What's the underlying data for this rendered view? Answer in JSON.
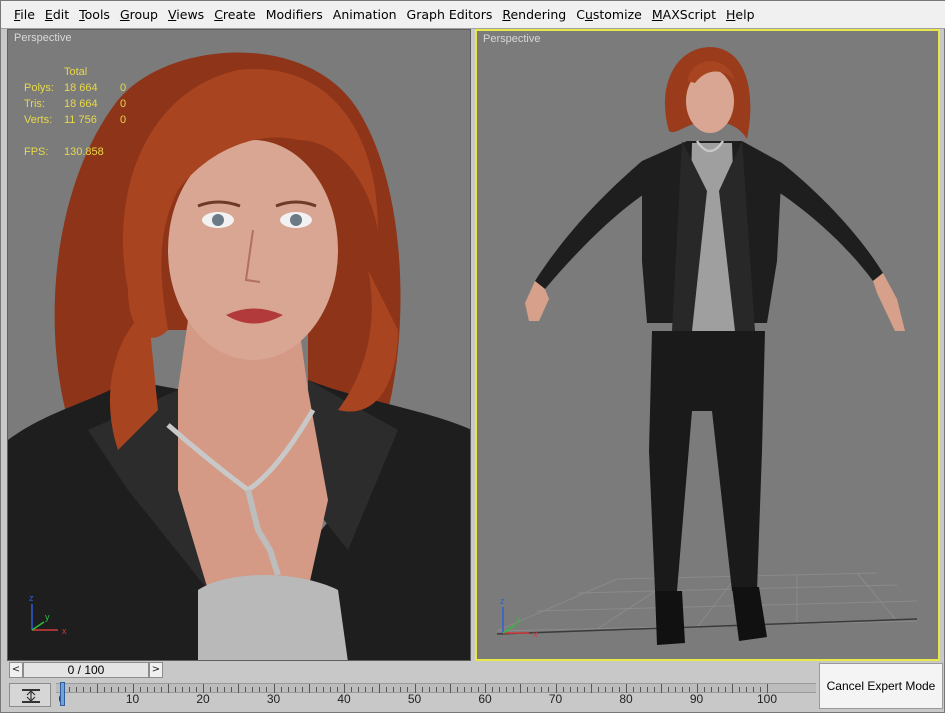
{
  "menu": [
    {
      "pre": "",
      "ul": "F",
      "post": "ile"
    },
    {
      "pre": "",
      "ul": "E",
      "post": "dit"
    },
    {
      "pre": "",
      "ul": "T",
      "post": "ools"
    },
    {
      "pre": "",
      "ul": "G",
      "post": "roup"
    },
    {
      "pre": "",
      "ul": "V",
      "post": "iews"
    },
    {
      "pre": "",
      "ul": "C",
      "post": "reate"
    },
    {
      "pre": "Modifiers",
      "ul": "",
      "post": ""
    },
    {
      "pre": "Animation",
      "ul": "",
      "post": ""
    },
    {
      "pre": "Graph Editors",
      "ul": "",
      "post": ""
    },
    {
      "pre": "",
      "ul": "R",
      "post": "endering"
    },
    {
      "pre": "C",
      "ul": "u",
      "post": "stomize"
    },
    {
      "pre": "",
      "ul": "M",
      "post": "AXScript"
    },
    {
      "pre": "",
      "ul": "H",
      "post": "elp"
    }
  ],
  "viewport_left": {
    "label": "Perspective",
    "stats": {
      "header": "Total",
      "rows": [
        {
          "key": "Polys:",
          "value": "18 664",
          "sel": "0"
        },
        {
          "key": "Tris:",
          "value": "18 664",
          "sel": "0"
        },
        {
          "key": "Verts:",
          "value": "11 756",
          "sel": "0"
        }
      ],
      "fps_key": "FPS:",
      "fps_value": "130.858"
    }
  },
  "viewport_right": {
    "label": "Perspective"
  },
  "timeline": {
    "frame_display": "0 / 100",
    "ticks": [
      "0",
      "10",
      "20",
      "30",
      "40",
      "50",
      "60",
      "70",
      "80",
      "90",
      "100"
    ],
    "current_frame": 0
  },
  "cancel_expert_label": "Cancel Expert Mode",
  "axis": {
    "x": "x",
    "y": "y",
    "z": "z"
  },
  "colors": {
    "viewport_bg": "#7b7b7b",
    "active_border": "#e8e84a",
    "stats_text": "#e8d84a",
    "hair": "#a0401e",
    "jacket": "#1c1c1c"
  },
  "icons": [
    "prev-frame-icon",
    "next-frame-icon",
    "trackbar-toggle-icon",
    "axis-gizmo-icon"
  ]
}
